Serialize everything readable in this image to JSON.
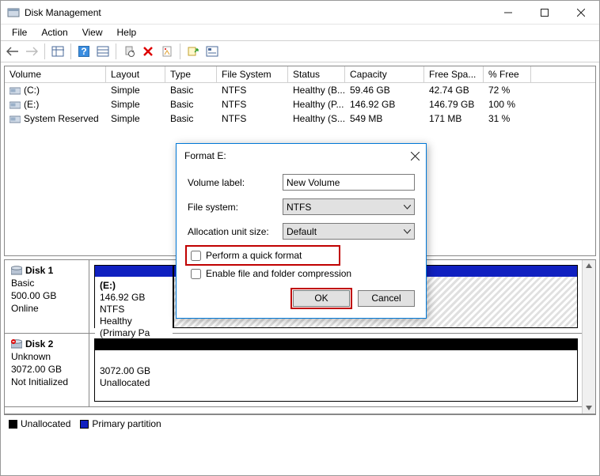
{
  "window": {
    "title": "Disk Management"
  },
  "menu": {
    "items": [
      "File",
      "Action",
      "View",
      "Help"
    ]
  },
  "columns": {
    "volume": "Volume",
    "layout": "Layout",
    "type": "Type",
    "fs": "File System",
    "status": "Status",
    "capacity": "Capacity",
    "free": "Free Spa...",
    "pct": "% Free"
  },
  "volumes": [
    {
      "name": "(C:)",
      "layout": "Simple",
      "type": "Basic",
      "fs": "NTFS",
      "status": "Healthy (B...",
      "capacity": "59.46 GB",
      "free": "42.74 GB",
      "pct": "72 %"
    },
    {
      "name": "(E:)",
      "layout": "Simple",
      "type": "Basic",
      "fs": "NTFS",
      "status": "Healthy (P...",
      "capacity": "146.92 GB",
      "free": "146.79 GB",
      "pct": "100 %"
    },
    {
      "name": "System Reserved",
      "layout": "Simple",
      "type": "Basic",
      "fs": "NTFS",
      "status": "Healthy (S...",
      "capacity": "549 MB",
      "free": "171 MB",
      "pct": "31 %"
    }
  ],
  "disk1": {
    "name": "Disk 1",
    "type": "Basic",
    "size": "500.00 GB",
    "state": "Online",
    "part": {
      "label": "(E:)",
      "detail": "146.92 GB NTFS",
      "status": "Healthy (Primary Pa"
    }
  },
  "disk2": {
    "name": "Disk 2",
    "type": "Unknown",
    "size": "3072.00 GB",
    "state": "Not Initialized",
    "part": {
      "label": "",
      "detail": "3072.00 GB",
      "status": "Unallocated"
    }
  },
  "legend": {
    "unalloc": "Unallocated",
    "primary": "Primary partition"
  },
  "dialog": {
    "title": "Format E:",
    "labels": {
      "vol": "Volume label:",
      "fs": "File system:",
      "au": "Allocation unit size:"
    },
    "values": {
      "vol": "New Volume",
      "fs": "NTFS",
      "au": "Default"
    },
    "chk_quick": "Perform a quick format",
    "chk_compress": "Enable file and folder compression",
    "ok": "OK",
    "cancel": "Cancel"
  }
}
